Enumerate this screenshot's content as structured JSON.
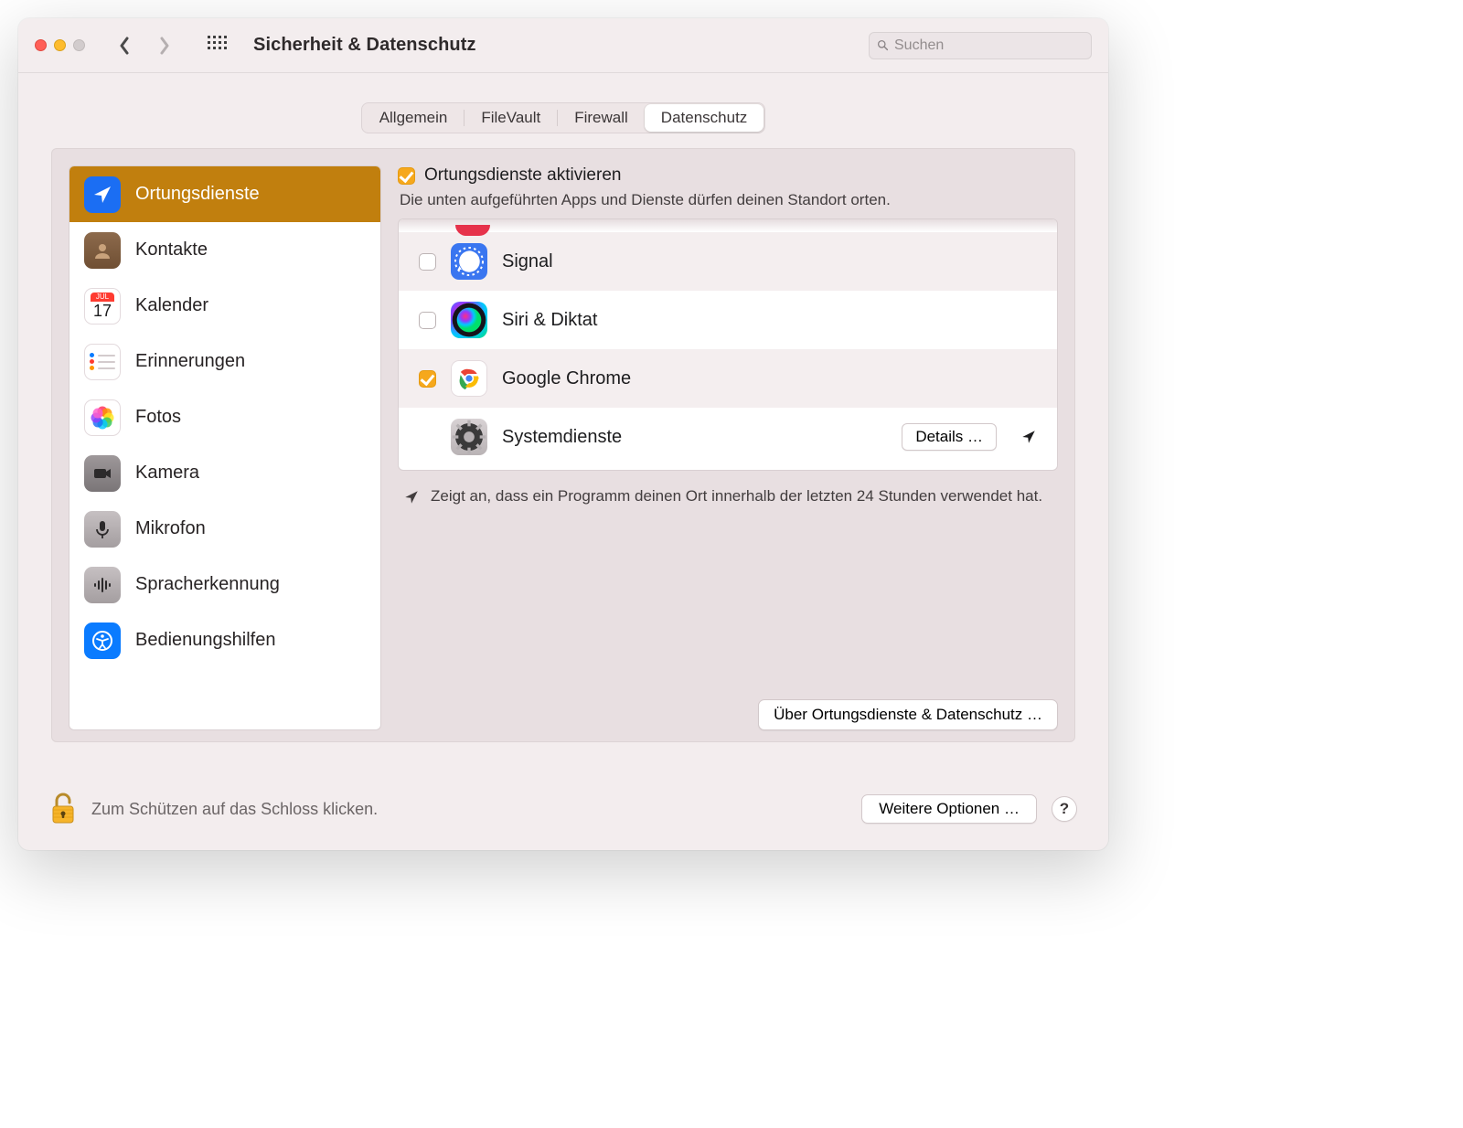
{
  "window": {
    "title": "Sicherheit & Datenschutz"
  },
  "search": {
    "placeholder": "Suchen"
  },
  "tabs": {
    "general": "Allgemein",
    "filevault": "FileVault",
    "firewall": "Firewall",
    "privacy": "Datenschutz"
  },
  "sidebar": {
    "items": [
      {
        "label": "Ortungsdienste"
      },
      {
        "label": "Kontakte"
      },
      {
        "label": "Kalender"
      },
      {
        "label": "Erinnerungen"
      },
      {
        "label": "Fotos"
      },
      {
        "label": "Kamera"
      },
      {
        "label": "Mikrofon"
      },
      {
        "label": "Spracherkennung"
      },
      {
        "label": "Bedienungshilfen"
      }
    ],
    "calendarMonth": "JUL",
    "calendarDay": "17"
  },
  "detail": {
    "enable_label": "Ortungsdienste aktivieren",
    "enable_desc": "Die unten aufgeführten Apps und Dienste dürfen deinen Standort orten.",
    "apps": [
      {
        "label": "Signal",
        "checked": false
      },
      {
        "label": "Siri & Diktat",
        "checked": false
      },
      {
        "label": "Google Chrome",
        "checked": true
      },
      {
        "label": "Systemdienste",
        "details": true
      }
    ],
    "details_label": "Details …",
    "legend": "Zeigt an, dass ein Programm deinen Ort innerhalb der letzten 24 Stunden verwendet hat.",
    "about_label": "Über Ortungsdienste & Datenschutz …"
  },
  "footer": {
    "lock_text": "Zum Schützen auf das Schloss klicken.",
    "more_label": "Weitere Optionen …",
    "help_label": "?"
  }
}
